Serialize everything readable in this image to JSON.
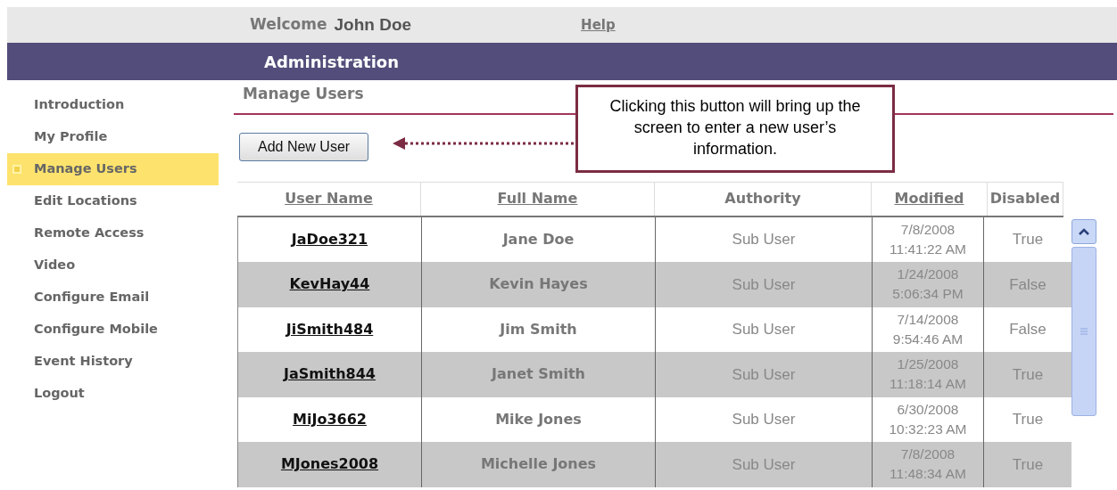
{
  "header": {
    "welcome": "Welcome",
    "user": "John Doe",
    "help": "Help"
  },
  "title_bar": "Administration",
  "sidebar": {
    "items": [
      {
        "label": "Introduction",
        "selected": false
      },
      {
        "label": "My Profile",
        "selected": false
      },
      {
        "label": "Manage Users",
        "selected": true
      },
      {
        "label": "Edit Locations",
        "selected": false
      },
      {
        "label": "Remote Access",
        "selected": false
      },
      {
        "label": "Video",
        "selected": false
      },
      {
        "label": "Configure Email",
        "selected": false
      },
      {
        "label": "Configure Mobile",
        "selected": false
      },
      {
        "label": "Event History",
        "selected": false
      },
      {
        "label": "Logout",
        "selected": false
      }
    ]
  },
  "page_title": "Manage Users",
  "add_button": "Add New User",
  "callout": "Clicking this button will bring up the screen to enter a new user’s information.",
  "table": {
    "columns": [
      {
        "label": "User Name",
        "sortable": true
      },
      {
        "label": "Full Name",
        "sortable": true
      },
      {
        "label": "Authority",
        "sortable": false
      },
      {
        "label": "Modified",
        "sortable": true
      },
      {
        "label": "Disabled",
        "sortable": false
      }
    ],
    "rows": [
      {
        "user_name": "JaDoe321",
        "full_name": "Jane Doe",
        "authority": "Sub User",
        "modified": [
          "7/8/2008",
          "11:41:22 AM"
        ],
        "disabled": "True"
      },
      {
        "user_name": "KevHay44",
        "full_name": "Kevin Hayes",
        "authority": "Sub User",
        "modified": [
          "1/24/2008",
          "5:06:34 PM"
        ],
        "disabled": "False"
      },
      {
        "user_name": "JiSmith484",
        "full_name": "Jim Smith",
        "authority": "Sub User",
        "modified": [
          "7/14/2008",
          "9:54:46 AM"
        ],
        "disabled": "False"
      },
      {
        "user_name": "JaSmith844",
        "full_name": "Janet Smith",
        "authority": "Sub User",
        "modified": [
          "1/25/2008",
          "11:18:14 AM"
        ],
        "disabled": "True"
      },
      {
        "user_name": "MiJo3662",
        "full_name": "Mike Jones",
        "authority": "Sub User",
        "modified": [
          "6/30/2008",
          "10:32:23 AM"
        ],
        "disabled": "True"
      },
      {
        "user_name": "MJones2008",
        "full_name": "Michelle Jones",
        "authority": "Sub User",
        "modified": [
          "7/8/2008",
          "11:48:34 AM"
        ],
        "disabled": "True"
      }
    ]
  }
}
